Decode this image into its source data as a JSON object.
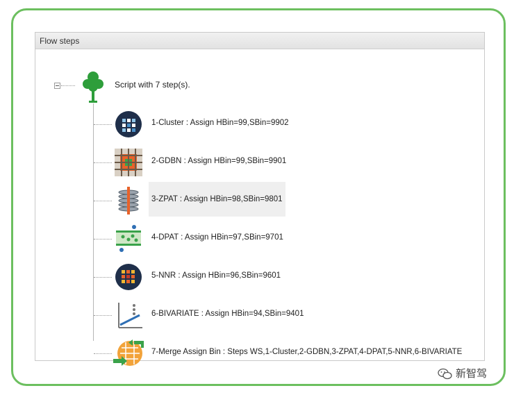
{
  "panel": {
    "title": "Flow steps"
  },
  "root": {
    "label": "Script with 7 step(s).",
    "icon": "tree-icon"
  },
  "steps": [
    {
      "label": "1-Cluster : Assign HBin=99,SBin=9902",
      "icon": "cluster-icon"
    },
    {
      "label": "2-GDBN : Assign HBin=99,SBin=9901",
      "icon": "gdbn-grid-icon"
    },
    {
      "label": "3-ZPAT : Assign HBin=98,SBin=9801",
      "icon": "zpat-stack-icon"
    },
    {
      "label": "4-DPAT : Assign HBin=97,SBin=9701",
      "icon": "dpat-icon"
    },
    {
      "label": "5-NNR : Assign HBin=96,SBin=9601",
      "icon": "nnr-icon"
    },
    {
      "label": "6-BIVARIATE : Assign HBin=94,SBin=9401",
      "icon": "bivariate-chart-icon"
    },
    {
      "label": "7-Merge Assign Bin : Steps WS,1-Cluster,2-GDBN,3-ZPAT,4-DPAT,5-NNR,6-BIVARIATE",
      "icon": "merge-icon"
    }
  ],
  "watermark": {
    "text": "新智驾",
    "icon": "wechat-icon"
  },
  "colors": {
    "frame": "#6cbf5f",
    "tree": "#2e9e3b",
    "orange": "#e8622a",
    "navy": "#1f2f4a"
  }
}
